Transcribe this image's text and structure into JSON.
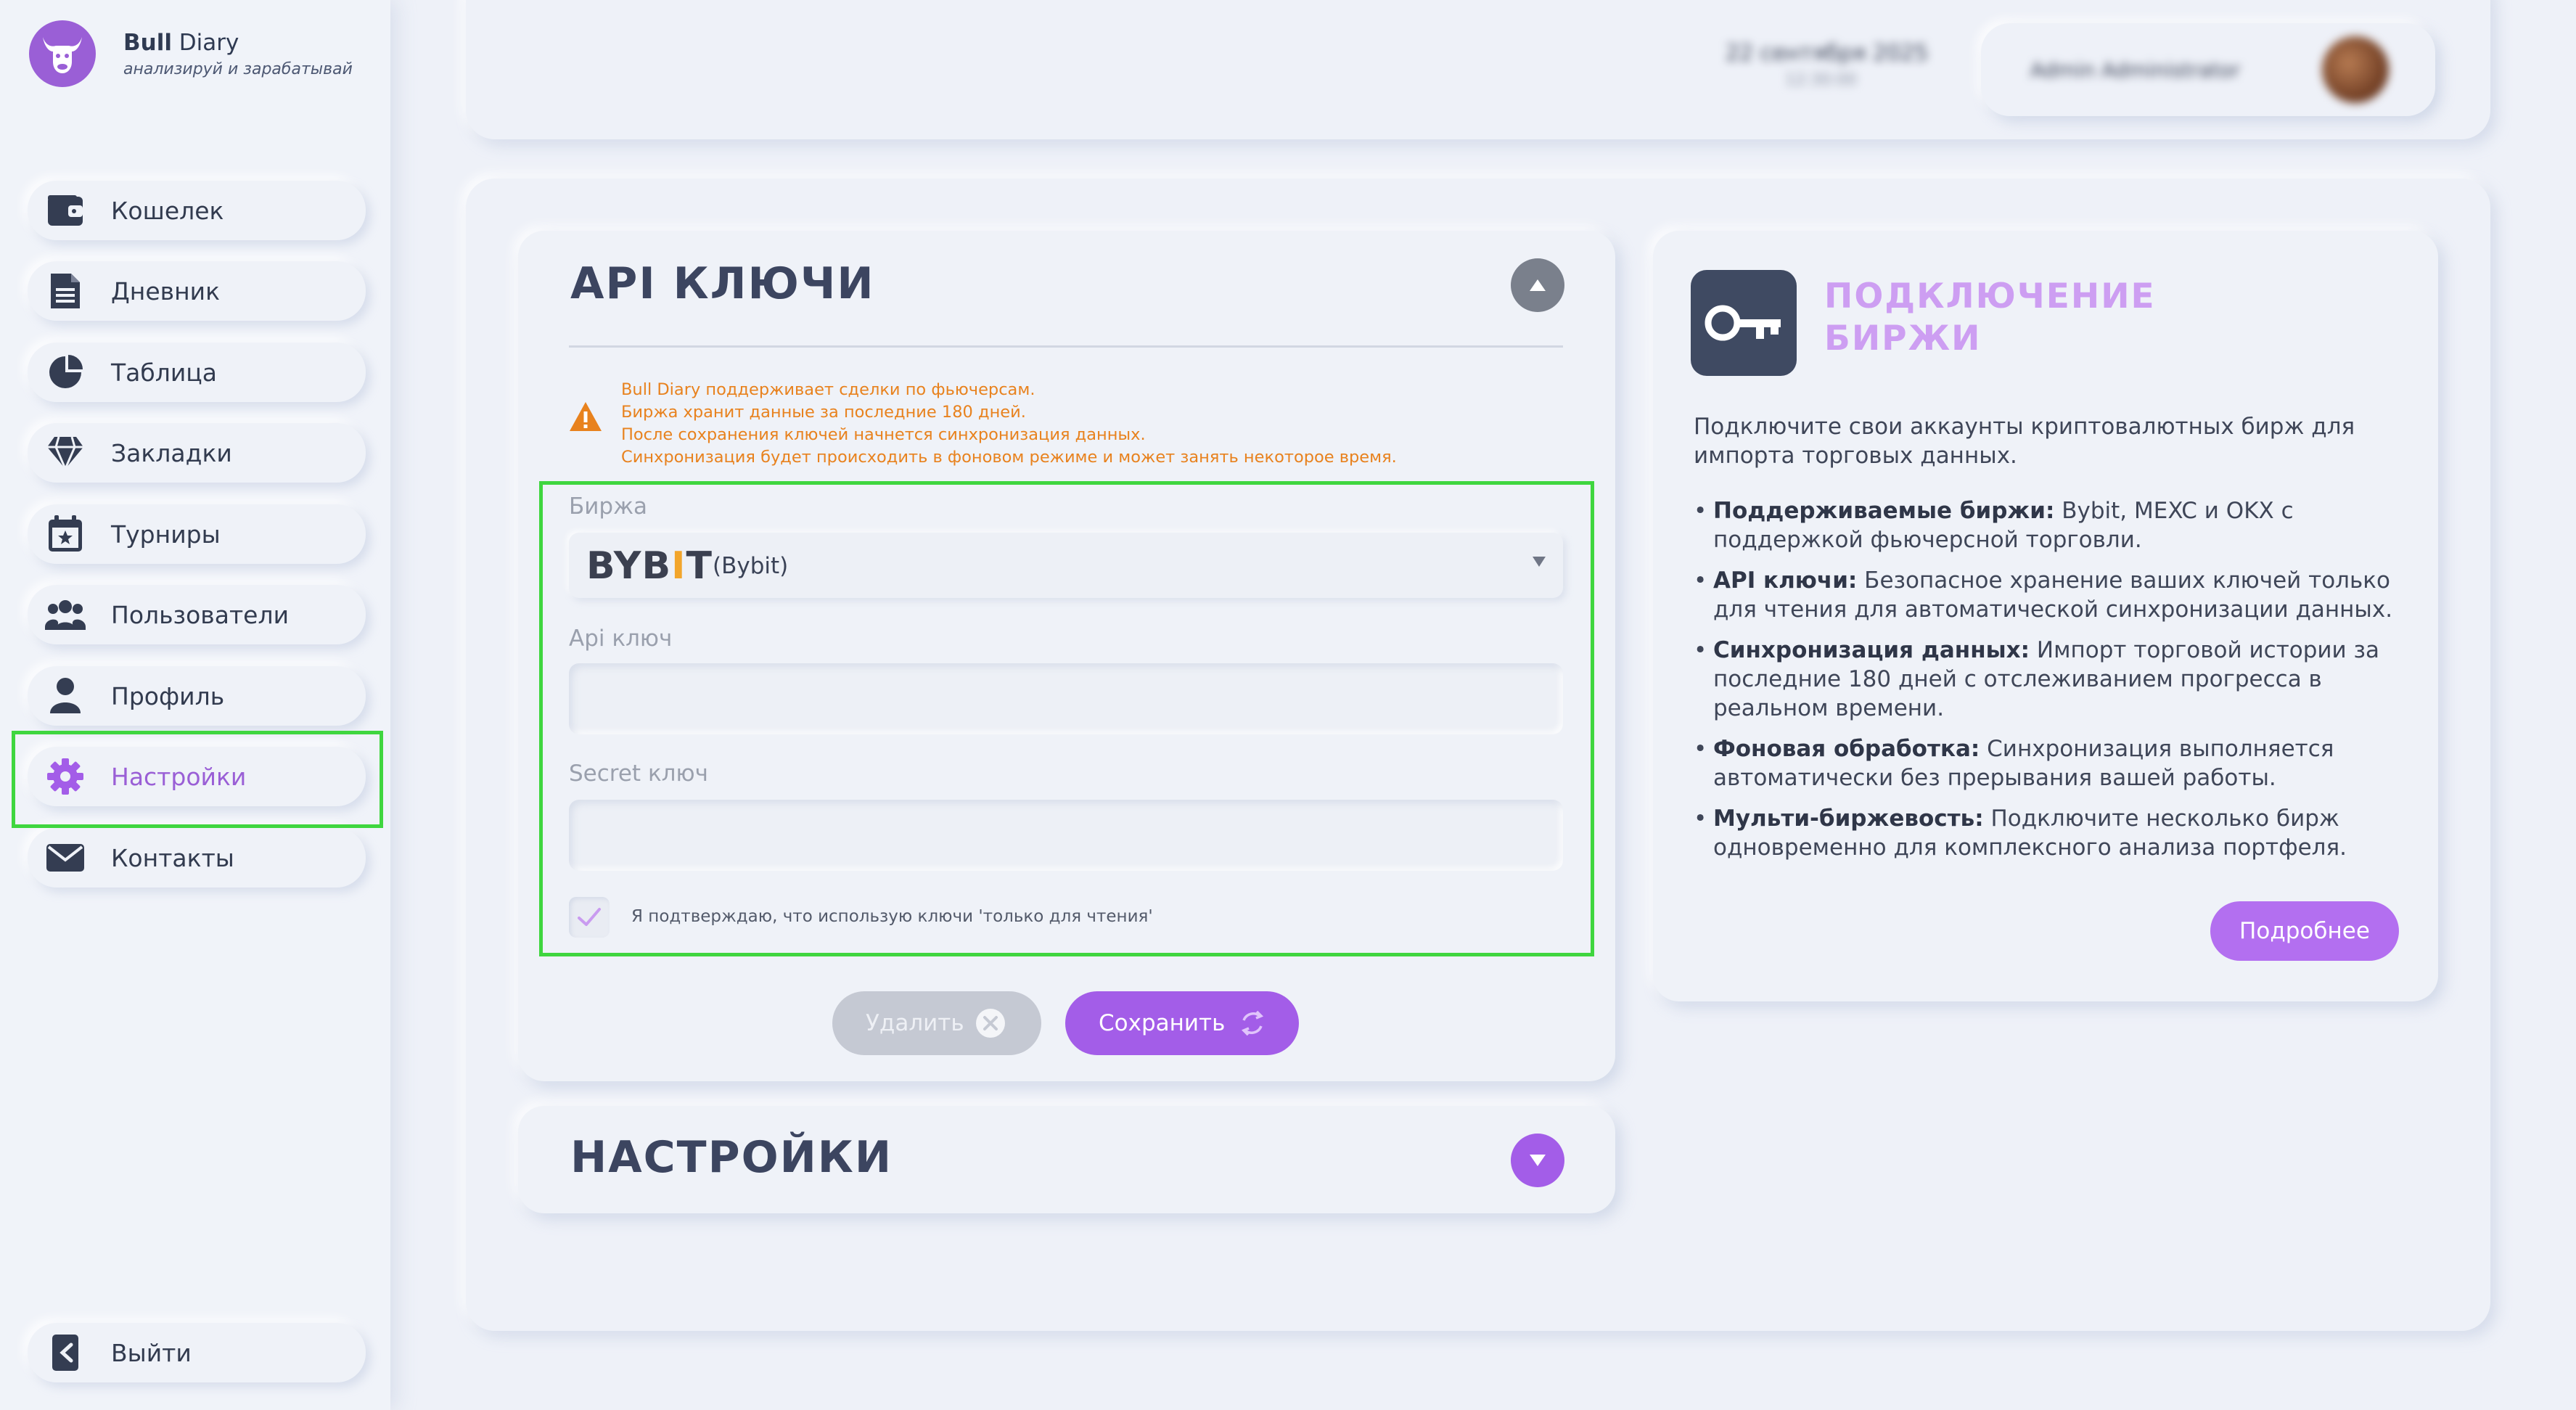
{
  "brand": {
    "name_bold": "Bull",
    "name_rest": " Diary",
    "tagline": "анализируй и зарабатывай"
  },
  "sidebar": {
    "items": [
      {
        "label": "Кошелек",
        "icon": "wallet-icon"
      },
      {
        "label": "Дневник",
        "icon": "document-icon"
      },
      {
        "label": "Таблица",
        "icon": "pie-chart-icon"
      },
      {
        "label": "Закладки",
        "icon": "gem-icon"
      },
      {
        "label": "Турниры",
        "icon": "calendar-star-icon"
      },
      {
        "label": "Пользователи",
        "icon": "users-icon"
      },
      {
        "label": "Профиль",
        "icon": "user-icon"
      },
      {
        "label": "Настройки",
        "icon": "gear-icon",
        "active": true
      },
      {
        "label": "Контакты",
        "icon": "envelope-icon"
      }
    ],
    "logout": {
      "label": "Выйти",
      "icon": "logout-icon"
    }
  },
  "header": {
    "date": "22 сентября 2025",
    "time": "12:30:00",
    "username": "Admin Administrator"
  },
  "api_card": {
    "title": "API КЛЮЧИ",
    "warning": [
      "Bull Diary поддерживает сделки по фьючерсам.",
      "Биржа хранит данные за последние 180 дней.",
      "После сохранения ключей начнется синхронизация данных.",
      "Синхронизация будет происходить в фоновом режиме и может занять некоторое время."
    ],
    "exchange_label": "Биржа",
    "exchange_logo_pre": "BYB",
    "exchange_logo_i": "I",
    "exchange_logo_post": "T",
    "exchange_name": "(Bybit)",
    "api_key_label": "Api ключ",
    "api_key_value": "",
    "secret_key_label": "Secret ключ",
    "secret_key_value": "",
    "confirm_label": "Я подтверждаю, что использую ключи 'только для чтения'",
    "confirm_checked": true,
    "delete_label": "Удалить",
    "save_label": "Сохранить"
  },
  "settings_card": {
    "title": "НАСТРОЙКИ"
  },
  "info_card": {
    "title_line1": "ПОДКЛЮЧЕНИЕ",
    "title_line2": "БИРЖИ",
    "intro": "Подключите свои аккаунты криптовалютных бирж для импорта торговых данных.",
    "bullets": [
      {
        "bold": "Поддерживаемые биржи:",
        "text": " Bybit, MEXC и OKX с поддержкой фьючерсной торговли."
      },
      {
        "bold": "API ключи:",
        "text": " Безопасное хранение ваших ключей только для чтения для автоматической синхронизации данных."
      },
      {
        "bold": "Синхронизация данных:",
        "text": " Импорт торговой истории за последние 180 дней с отслеживанием прогресса в реальном времени."
      },
      {
        "bold": "Фоновая обработка:",
        "text": " Синхронизация выполняется автоматически без прерывания вашей работы."
      },
      {
        "bold": "Мульти-биржевость:",
        "text": " Подключите несколько бирж одновременно для комплексного анализа портфеля."
      }
    ],
    "more_label": "Подробнее"
  },
  "colors": {
    "accent": "#a35de8",
    "warning": "#e8821e",
    "highlight": "#3fd63f",
    "text": "#323b4f"
  }
}
